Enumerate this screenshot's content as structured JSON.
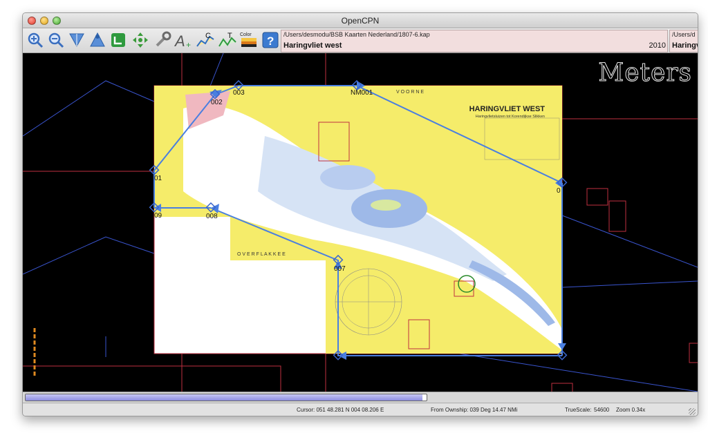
{
  "window": {
    "title": "OpenCPN"
  },
  "toolbar": {
    "tools": [
      {
        "name": "zoom-in-icon",
        "glyph": "🔍"
      },
      {
        "name": "zoom-out-icon",
        "glyph": "🔎"
      },
      {
        "name": "scale-down-icon",
        "glyph": "▼"
      },
      {
        "name": "ownship-icon",
        "glyph": "▲"
      },
      {
        "name": "follow-icon",
        "glyph": "◧"
      },
      {
        "name": "route-icon",
        "glyph": "✥"
      },
      {
        "name": "settings-wrench-icon",
        "glyph": "🔧"
      },
      {
        "name": "text-icon",
        "glyph": "A"
      },
      {
        "name": "current-icon",
        "glyph": "C"
      },
      {
        "name": "tide-icon",
        "glyph": "T"
      },
      {
        "name": "color-scheme-icon",
        "glyph": "▬"
      },
      {
        "name": "help-icon",
        "glyph": "?"
      }
    ],
    "tide_label": "C",
    "tide2_label": "T",
    "color_label": "Color",
    "chart1": {
      "path": "/Users/desmodu/BSB Kaarten Nederland/1807-6.kap",
      "name": "Haringvliet west",
      "year": "2010"
    },
    "chart2": {
      "path": "/Users/d",
      "name": "Haringv"
    }
  },
  "canvas": {
    "meters_label": "Meters",
    "chart_title": "HARINGVLIET WEST",
    "chart_subtitle": "Haringvlietsluizen tot Korendijkse Slikken",
    "place_voorne": "V O O R N E",
    "place_overflakkee": "O V E R F L A K K E E",
    "waypoints": [
      "003",
      "002",
      "NM001",
      "01",
      "09",
      "008",
      "007",
      "0"
    ]
  },
  "progress": {
    "fraction": 0.99
  },
  "status": {
    "cursor": "Cursor: 051 48.281 N 004 08.206 E",
    "ownship": "From Ownship: 039 Deg   14.47 NMi",
    "truescale_label": "TrueScale:",
    "truescale_value": "54600",
    "zoom": "Zoom 0.34x"
  },
  "colors": {
    "route": "#4a7fe0",
    "chart_land": "#f5ec6a",
    "chart_border": "#d04050"
  }
}
